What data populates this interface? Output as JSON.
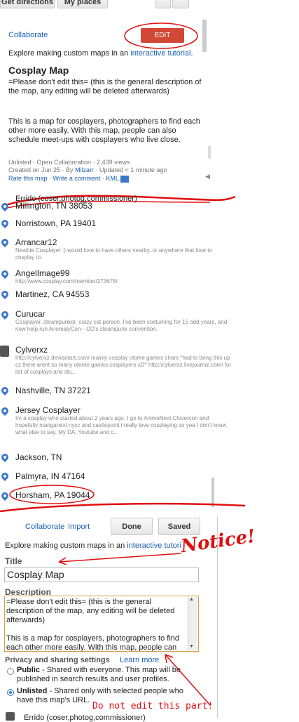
{
  "toolbar": {
    "get_directions": "Get directions",
    "my_places": "My places"
  },
  "top_panel": {
    "collaborate": "Collaborate",
    "edit": "EDIT",
    "explore_prefix": "Explore making custom maps in an ",
    "explore_link": "interactive tutorial",
    "explore_suffix": ".",
    "title": "Cosplay Map",
    "desc1": "=Please don't edit this= (this is the general description of the map, any editing will be deleted afterwards)",
    "desc2": "This is a map for cosplayers, photographers to find each other more easily. With this map, people can also schedule meet-ups with cosplayers who live close.",
    "meta1_prefix": "Unlisted · Open Collaboration · 2,439 views",
    "meta2_prefix": "Created on Jun 25 · By ",
    "meta2_user": "Milzarr",
    "meta2_suffix": " · Updated < 1 minute ago",
    "rate": "Rate this map",
    "sep1": " · ",
    "write_comment": "Write a comment",
    "sep2": " · ",
    "kml": "KML"
  },
  "places": [
    {
      "name": "Errido (coser,photog,commissioner)"
    },
    {
      "name": "Millington, TN 38053"
    },
    {
      "name": "Norristown, PA 19401"
    },
    {
      "name": "Arrancar12",
      "desc": "Newbie Cosplayer :) would love to have others nearby..or anywhere that love to cosplay to."
    },
    {
      "name": "AngelImage99",
      "desc": "http://www.cosplay.com/member/273678/"
    },
    {
      "name": "Martinez, CA 94553"
    },
    {
      "name": "Curucar",
      "desc": "Cosplayer, steampunker, crazy cat person. I've been costuming for 15 odd years, and now help run AnomalyCon-- CO's steampunk convention."
    },
    {
      "name": "Cylverxz",
      "desc": "http://cylverxz.deviantart.com/ mainly cosplay otome games chars *had to bring this up cz there arent so many otome games cosplayers xD* http://cylverxz.livejournal.com/ for list of cosplays and stu..."
    },
    {
      "name": "Nashville, TN 37221"
    },
    {
      "name": "Jersey Cosplayer",
      "desc": "Im a cosplay who started about 2 years ago. I go to AnimeNext Clovercon and hopefully manganext nycc and castlepoint i really love cosplaying so yea I don't know what else to say. My DA, Youtube and c..."
    },
    {
      "name": "Jackson, TN"
    },
    {
      "name": "Palmyra, IN 47164"
    },
    {
      "name": "Horsham, PA 19044"
    }
  ],
  "edit_panel": {
    "collaborate": "Collaborate",
    "import": "Import",
    "done": "Done",
    "saved": "Saved",
    "explore_prefix": "Explore making custom maps in an ",
    "explore_link": "interactive tutori",
    "title_label": "Title",
    "title_value": "Cosplay Map",
    "description_label": "Description",
    "description_value": "=Please don't edit this= (this is the general description of the map, any editing will be deleted afterwards)\n\nThis is a map for cosplayers, photographers to find each other more easily. With this map, people can",
    "privacy_label": "Privacy and sharing settings",
    "learn_more": "Learn more",
    "public_label": "Public",
    "public_desc": " - Shared with everyone. This map will be published in search results and user profiles.",
    "unlisted_label": "Unlisted",
    "unlisted_desc": " - Shared only with selected people who have this map's URL.",
    "bottom_item": "Errido (coser,photog,commissioner)"
  },
  "annotations": {
    "notice": "Notice!",
    "do_not_edit": "Do not edit this part!"
  },
  "colors": {
    "accent_red": "#d14836",
    "link": "#1a5fb4",
    "marker": "#3b78c9",
    "annotation": "#e01010"
  }
}
